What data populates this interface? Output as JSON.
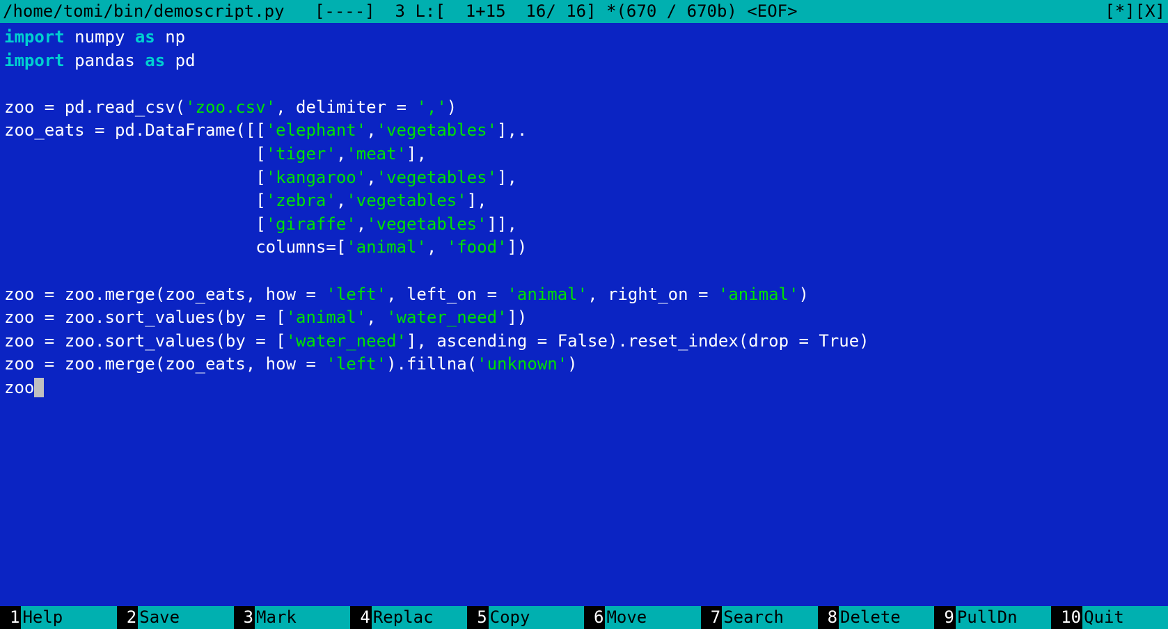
{
  "titlebar": {
    "path": "/home/tomi/bin/demoscript.py",
    "flags": "[----]",
    "col": "3",
    "line_prefix": "L:[",
    "scroll": "1+15",
    "line_pos": "16/ 16]",
    "bytes": "*(670 / 670b)",
    "eof": "<EOF>",
    "modified": "[*]",
    "encoding": "[X]"
  },
  "code": {
    "lines": [
      {
        "t": "imp",
        "tok": [
          [
            "kw",
            "import"
          ],
          [
            "",
            " numpy "
          ],
          [
            "kw",
            "as"
          ],
          [
            "",
            " np"
          ]
        ]
      },
      {
        "t": "imp",
        "tok": [
          [
            "kw",
            "import"
          ],
          [
            "",
            " pandas "
          ],
          [
            "kw",
            "as"
          ],
          [
            "",
            " pd"
          ]
        ]
      },
      {
        "t": "blank",
        "tok": [
          [
            "",
            ""
          ]
        ]
      },
      {
        "t": "",
        "tok": [
          [
            "",
            "zoo = pd.read_csv("
          ],
          [
            "str",
            "'zoo.csv'"
          ],
          [
            "",
            ", delimiter = "
          ],
          [
            "str",
            "','"
          ],
          [
            "",
            ")"
          ]
        ]
      },
      {
        "t": "",
        "tok": [
          [
            "",
            "zoo_eats = pd.DataFrame([["
          ],
          [
            "str",
            "'elephant'"
          ],
          [
            "",
            ","
          ],
          [
            "str",
            "'vegetables'"
          ],
          [
            "",
            "],."
          ]
        ]
      },
      {
        "t": "",
        "tok": [
          [
            "",
            "                         ["
          ],
          [
            "str",
            "'tiger'"
          ],
          [
            "",
            ","
          ],
          [
            "str",
            "'meat'"
          ],
          [
            "",
            "],"
          ]
        ]
      },
      {
        "t": "",
        "tok": [
          [
            "",
            "                         ["
          ],
          [
            "str",
            "'kangaroo'"
          ],
          [
            "",
            ","
          ],
          [
            "str",
            "'vegetables'"
          ],
          [
            "",
            "],"
          ]
        ]
      },
      {
        "t": "",
        "tok": [
          [
            "",
            "                         ["
          ],
          [
            "str",
            "'zebra'"
          ],
          [
            "",
            ","
          ],
          [
            "str",
            "'vegetables'"
          ],
          [
            "",
            "],"
          ]
        ]
      },
      {
        "t": "",
        "tok": [
          [
            "",
            "                         ["
          ],
          [
            "str",
            "'giraffe'"
          ],
          [
            "",
            ","
          ],
          [
            "str",
            "'vegetables'"
          ],
          [
            "",
            "]],"
          ]
        ]
      },
      {
        "t": "",
        "tok": [
          [
            "",
            "                         columns=["
          ],
          [
            "str",
            "'animal'"
          ],
          [
            "",
            ", "
          ],
          [
            "str",
            "'food'"
          ],
          [
            "",
            "])"
          ]
        ]
      },
      {
        "t": "blank",
        "tok": [
          [
            "",
            ""
          ]
        ]
      },
      {
        "t": "",
        "tok": [
          [
            "",
            "zoo = zoo.merge(zoo_eats, how = "
          ],
          [
            "str",
            "'left'"
          ],
          [
            "",
            ", left_on = "
          ],
          [
            "str",
            "'animal'"
          ],
          [
            "",
            ", right_on = "
          ],
          [
            "str",
            "'animal'"
          ],
          [
            "",
            ")"
          ]
        ]
      },
      {
        "t": "",
        "tok": [
          [
            "",
            "zoo = zoo.sort_values(by = ["
          ],
          [
            "str",
            "'animal'"
          ],
          [
            "",
            ", "
          ],
          [
            "str",
            "'water_need'"
          ],
          [
            "",
            "])"
          ]
        ]
      },
      {
        "t": "",
        "tok": [
          [
            "",
            "zoo = zoo.sort_values(by = ["
          ],
          [
            "str",
            "'water_need'"
          ],
          [
            "",
            "], ascending = False).reset_index(drop = True)"
          ]
        ]
      },
      {
        "t": "",
        "tok": [
          [
            "",
            "zoo = zoo.merge(zoo_eats, how = "
          ],
          [
            "str",
            "'left'"
          ],
          [
            "",
            ").fillna("
          ],
          [
            "str",
            "'unknown'"
          ],
          [
            "",
            ")"
          ]
        ]
      },
      {
        "t": "cursor",
        "tok": [
          [
            "",
            "zoo"
          ]
        ]
      }
    ]
  },
  "menubar": [
    {
      "key": "1",
      "label": "Help"
    },
    {
      "key": "2",
      "label": "Save"
    },
    {
      "key": "3",
      "label": "Mark"
    },
    {
      "key": "4",
      "label": "Replac"
    },
    {
      "key": "5",
      "label": "Copy"
    },
    {
      "key": "6",
      "label": "Move"
    },
    {
      "key": "7",
      "label": "Search"
    },
    {
      "key": "8",
      "label": "Delete"
    },
    {
      "key": "9",
      "label": "PullDn"
    },
    {
      "key": "10",
      "label": "Quit"
    }
  ]
}
